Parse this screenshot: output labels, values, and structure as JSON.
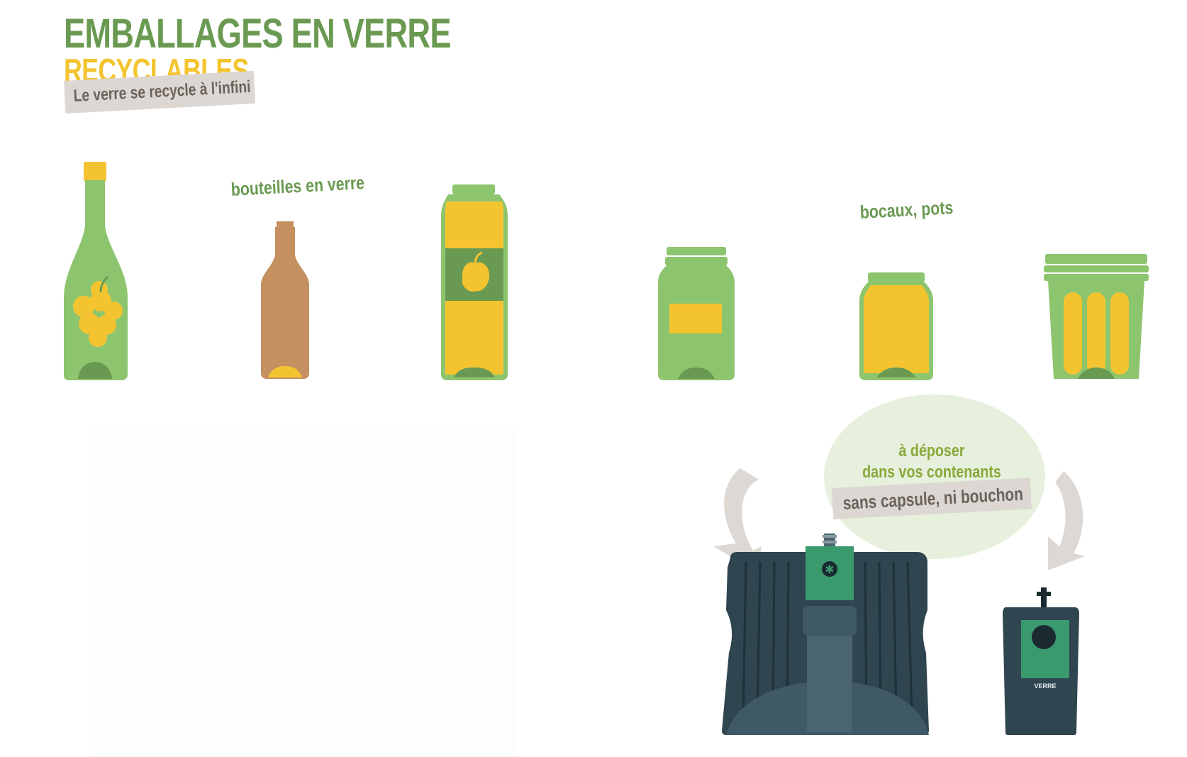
{
  "header": {
    "title": "EMBALLAGES EN VERRE",
    "subtitle": "RECYCLABLES",
    "tagline": "Le verre se recycle à l'infini"
  },
  "categories": {
    "bottles_label": "bouteilles en verre",
    "jars_label": "bocaux, pots"
  },
  "deposit": {
    "line1": "à déposer",
    "line2": "dans vos contenants",
    "note": "sans capsule, ni bouchon",
    "bin_label": "VERRE"
  },
  "colors": {
    "green": "#8dc56f",
    "dark_green": "#6a9a52",
    "yellow": "#f4c430",
    "brown": "#c49060",
    "container_dark": "#2f4550",
    "container_panel": "#3a9a6e",
    "arrow_grey": "#ddd8d3",
    "bubble_green": "#e6f0dc"
  },
  "icons": [
    "wine-bottle-icon",
    "beer-bottle-icon",
    "juice-bottle-icon",
    "jar-icon",
    "honey-jar-icon",
    "pot-icon",
    "glass-container-icon",
    "glass-bin-icon",
    "arrow-icon"
  ]
}
